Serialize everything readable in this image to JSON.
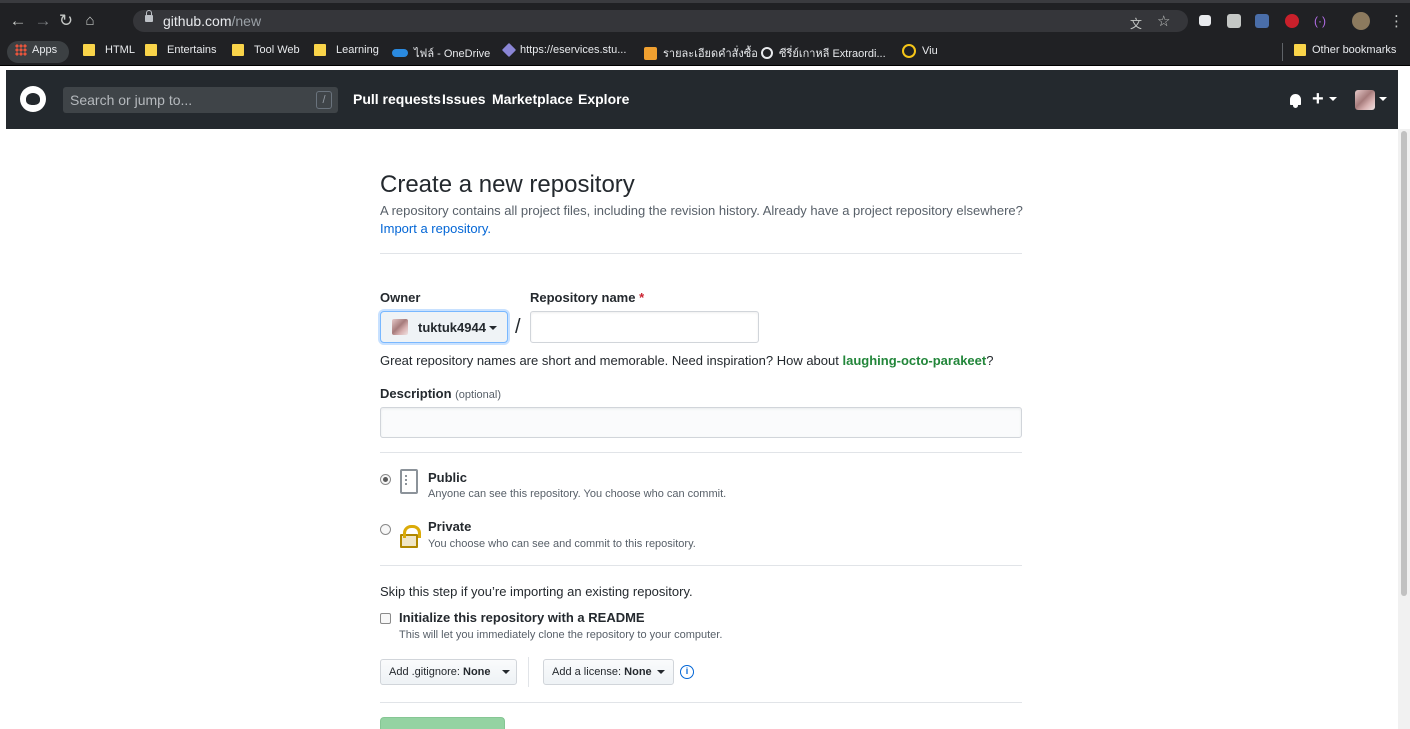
{
  "browser": {
    "url_host": "github.com",
    "url_path": "/new",
    "bookmarks": [
      {
        "label": "Apps",
        "kind": "apps"
      },
      {
        "label": "HTML",
        "kind": "folder"
      },
      {
        "label": "Entertains",
        "kind": "folder"
      },
      {
        "label": "Tool Web",
        "kind": "folder"
      },
      {
        "label": "Learning",
        "kind": "folder"
      },
      {
        "label": "ไฟล์ - OneDrive",
        "kind": "onedrive"
      },
      {
        "label": "https://eservices.stu...",
        "kind": "link"
      },
      {
        "label": "รายละเอียดคำสั่งซื้อ",
        "kind": "shop"
      },
      {
        "label": "ซีรี่ย์เกาหลี Extraordi...",
        "kind": "globe"
      },
      {
        "label": "Viu",
        "kind": "viu"
      }
    ],
    "other_bookmarks": "Other bookmarks"
  },
  "header": {
    "search_placeholder": "Search or jump to...",
    "search_key": "/",
    "nav": [
      "Pull requests",
      "Issues",
      "Marketplace",
      "Explore"
    ],
    "plus": "+"
  },
  "page": {
    "title": "Create a new repository",
    "description": "A repository contains all project files, including the revision history. Already have a project repository elsewhere?",
    "import_link": "Import a repository.",
    "owner_label": "Owner",
    "owner_value": "tuktuk4944",
    "repo_name_label": "Repository name",
    "required_mark": "*",
    "separator": "/",
    "repo_name_value": "",
    "hint_prefix": "Great repository names are short and memorable. Need inspiration? How about",
    "hint_suggestion": "laughing-octo-parakeet",
    "hint_suffix": "?",
    "description_label": "Description",
    "description_optional": "(optional)",
    "description_value": "",
    "visibility": {
      "selected": "public",
      "public_title": "Public",
      "public_note": "Anyone can see this repository. You choose who can commit.",
      "private_title": "Private",
      "private_note": "You choose who can see and commit to this repository."
    },
    "skip_text": "Skip this step if you’re importing an existing repository.",
    "readme_label": "Initialize this repository with a README",
    "readme_note": "This will let you immediately clone the repository to your computer.",
    "readme_checked": false,
    "gitignore_label": "Add .gitignore:",
    "gitignore_value": "None",
    "license_label": "Add a license:",
    "license_value": "None",
    "info_icon": "i"
  },
  "colors": {
    "chrome_bg": "#202124",
    "github_header": "#24292e",
    "link": "#0366d6",
    "suggestion": "#22863a",
    "create_button": "#94d3a2"
  }
}
